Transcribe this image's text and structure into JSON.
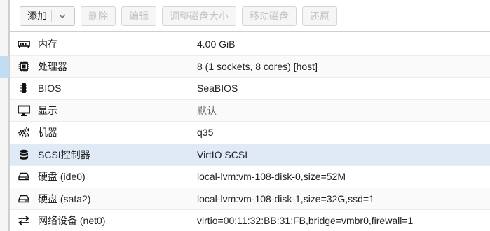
{
  "toolbar": {
    "add_label": "添加",
    "remove_label": "删除",
    "edit_label": "编辑",
    "resize_label": "调整磁盘大小",
    "move_label": "移动磁盘",
    "revert_label": "还原"
  },
  "hardware": {
    "rows": [
      {
        "icon": "memory-icon",
        "name": "内存",
        "value": "4.00 GiB"
      },
      {
        "icon": "cpu-icon",
        "name": "处理器",
        "value": "8 (1 sockets, 8 cores) [host]"
      },
      {
        "icon": "bios-chip-icon",
        "name": "BIOS",
        "value": "SeaBIOS"
      },
      {
        "icon": "monitor-icon",
        "name": "显示",
        "value": "默认"
      },
      {
        "icon": "cogs-icon",
        "name": "机器",
        "value": "q35"
      },
      {
        "icon": "database-icon",
        "name": "SCSI控制器",
        "value": "VirtIO SCSI"
      },
      {
        "icon": "hdd-icon",
        "name": "硬盘 (ide0)",
        "value": "local-lvm:vm-108-disk-0,size=52M"
      },
      {
        "icon": "hdd-icon",
        "name": "硬盘 (sata2)",
        "value": "local-lvm:vm-108-disk-1,size=32G,ssd=1"
      },
      {
        "icon": "exchange-icon",
        "name": "网络设备 (net0)",
        "value": "virtio=00:11:32:BB:31:FB,bridge=vmbr0,firewall=1"
      }
    ]
  },
  "colors": {
    "selected_row": "#dfeaf6",
    "left_selection": "#c2ddf2"
  }
}
